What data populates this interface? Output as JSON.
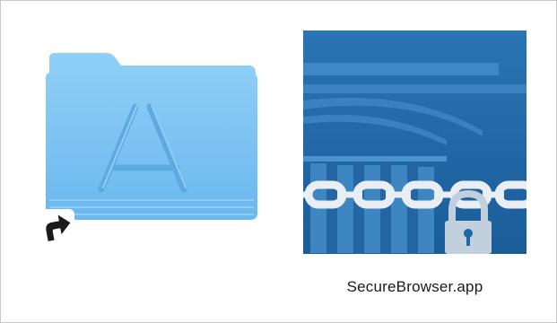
{
  "window": {
    "background": "#ffffff",
    "border_color": "#c8c8c8"
  },
  "alias_item": {
    "icon": "applications-folder-icon",
    "badge_icon": "alias-arrow-icon",
    "folder_color": "#7cc3f2"
  },
  "app_item": {
    "icon": "secure-browser-app-icon",
    "label": "SecureBrowser.app",
    "icon_background": "#1f67a6",
    "chain_color": "#e8eef3",
    "lock_color": "#c2d0dd"
  }
}
